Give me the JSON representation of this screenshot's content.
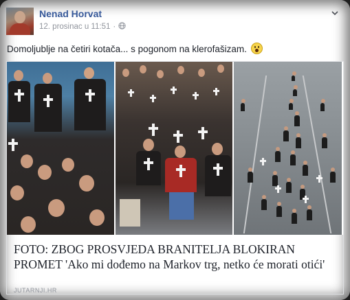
{
  "post": {
    "author_name": "Nenad Horvat",
    "timestamp": "12. prosinac u 11:51",
    "separator": "·",
    "privacy_icon": "globe-icon",
    "menu_icon": "chevron-down-icon",
    "text": "Domoljublje na četiri kotača... s pogonom na klerofašizam.",
    "emoji": "surprised-face"
  },
  "link_preview": {
    "title": "FOTO: ZBOG PROSVJEDA BRANITELJA BLOKIRAN PROMET 'Ako mi dođemo na Markov trg, netko će morati otići'",
    "source": "JUTARNJI.HR"
  },
  "colors": {
    "author": "#365899",
    "meta": "#90949c",
    "text": "#1d2129",
    "border": "#dddfe2"
  }
}
